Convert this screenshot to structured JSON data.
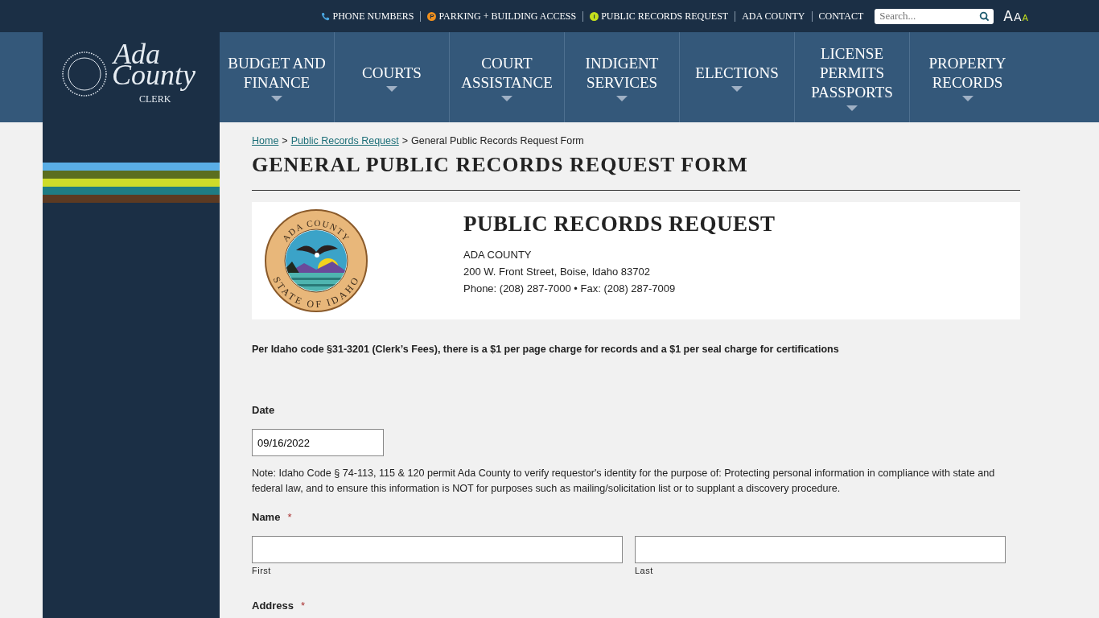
{
  "top_links": [
    {
      "label": "PHONE NUMBERS",
      "kind": "phone"
    },
    {
      "label": "PARKING + BUILDING ACCESS",
      "kind": "badge",
      "badge": "P",
      "color": "#f0901e"
    },
    {
      "label": "PUBLIC RECORDS REQUEST",
      "kind": "badge",
      "badge": "i",
      "color": "#c4e01c"
    },
    {
      "label": "ADA COUNTY",
      "kind": "plain"
    },
    {
      "label": "CONTACT",
      "kind": "plain"
    }
  ],
  "search": {
    "placeholder": "Search..."
  },
  "font_size_buttons": [
    {
      "label": "A",
      "selected": false
    },
    {
      "label": "A",
      "selected": false
    },
    {
      "label": "A",
      "selected": true
    }
  ],
  "logo": {
    "line_1": "Ada",
    "line_2": "County",
    "line_3": "CLERK"
  },
  "nav": [
    {
      "label": "BUDGET AND FINANCE"
    },
    {
      "label": "COURTS"
    },
    {
      "label": "COURT ASSISTANCE"
    },
    {
      "label": "INDIGENT SERVICES"
    },
    {
      "label": "ELECTIONS"
    },
    {
      "label": "LICENSE PERMITS PASSPORTS"
    },
    {
      "label": "PROPERTY RECORDS"
    }
  ],
  "stripes": [
    {
      "color": "#5aaee6"
    },
    {
      "color": "#5b6e1f"
    },
    {
      "color": "#cddc2a"
    },
    {
      "color": "#1f7c84"
    },
    {
      "color": "#5c3a22"
    }
  ],
  "breadcrumb": {
    "separator": ">",
    "links": [
      "Home",
      "Public Records Request"
    ],
    "current": "General Public Records Request Form"
  },
  "page_title": "GENERAL PUBLIC RECORDS REQUEST FORM",
  "header_card": {
    "seal_top": "ADA COUNTY",
    "seal_bottom": "STATE OF IDAHO",
    "title": "PUBLIC RECORDS REQUEST",
    "lines": [
      "ADA COUNTY",
      "200 W. Front Street, Boise, Idaho 83702",
      "Phone: (208) 287-7000 • Fax: (208) 287-7009"
    ]
  },
  "fee_note": "Per Idaho code §31-3201 (Clerk’s Fees), there is a $1 per page charge for records and a $1 per seal charge for certifications",
  "date_field": {
    "label": "Date",
    "value": "09/16/2022"
  },
  "id_note": "Note: Idaho Code § 74-113, 115 & 120 permit Ada County to verify requestor's identity for the purpose of: Protecting personal information in compliance with state and federal law, and to ensure this information is NOT for purposes such as mailing/solicitation list or to supplant a discovery procedure.",
  "name_field": {
    "label": "Name",
    "required_mark": "*",
    "parts": [
      {
        "sublabel": "First"
      },
      {
        "sublabel": "Last"
      }
    ]
  },
  "address_field": {
    "label": "Address",
    "required_mark": "*"
  }
}
